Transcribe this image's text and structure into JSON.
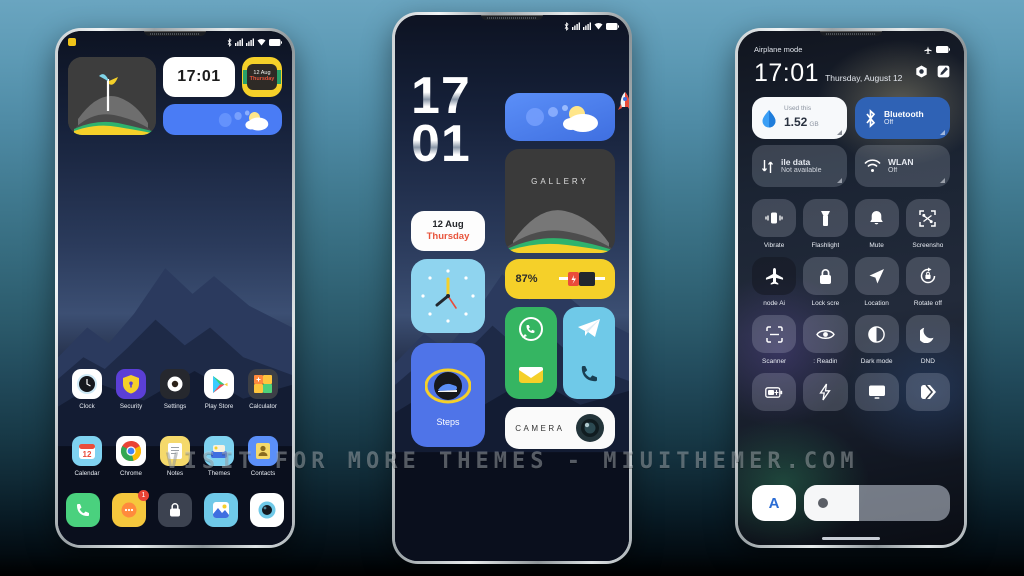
{
  "watermark": "VISIT FOR MORE THEMES - MIUITHEMER.COM",
  "colors": {
    "accent_yellow": "#f5d029",
    "accent_blue": "#4a7cf5",
    "accent_green": "#35b562",
    "accent_red": "#e8543c",
    "cyan": "#6fc9e8",
    "bg_top": "#6aa5c0",
    "bg_bottom": "#000000"
  },
  "phone1": {
    "name": "home-screen",
    "statusbar": {
      "left_badge_icon": "yellow-badge-icon",
      "icons": [
        "bluetooth-icon",
        "signal-1-icon",
        "signal-2-icon",
        "wifi-icon",
        "battery-icon"
      ]
    },
    "widgets": {
      "photo_widget_name": "photo-widget",
      "clock_time": "17:01",
      "date_day": "12 Aug",
      "date_weekday": "Thursday",
      "weather_widget_name": "weather-widget"
    },
    "apps_row1": [
      {
        "label": "Clock",
        "icon": "clock-icon"
      },
      {
        "label": "Security",
        "icon": "shield-icon"
      },
      {
        "label": "Settings",
        "icon": "gear-icon"
      },
      {
        "label": "Play Store",
        "icon": "play-store-icon"
      },
      {
        "label": "Calculator",
        "icon": "calculator-icon"
      }
    ],
    "apps_row2": [
      {
        "label": "Calendar",
        "icon": "calendar-icon"
      },
      {
        "label": "Chrome",
        "icon": "chrome-icon"
      },
      {
        "label": "Notes",
        "icon": "notes-icon"
      },
      {
        "label": "Themes",
        "icon": "themes-icon"
      },
      {
        "label": "Contacts",
        "icon": "contacts-icon"
      }
    ],
    "page_dots": 2,
    "page_active": 1,
    "dock": [
      {
        "name": "phone",
        "icon": "phone-icon"
      },
      {
        "name": "messages",
        "icon": "messages-icon",
        "badge": "1"
      },
      {
        "name": "app-lock",
        "icon": "lock-icon"
      },
      {
        "name": "gallery",
        "icon": "gallery-icon"
      },
      {
        "name": "camera",
        "icon": "camera-icon"
      }
    ]
  },
  "phone2": {
    "name": "widget-home-screen",
    "statusbar": {
      "icons": [
        "bluetooth-icon",
        "signal-1-icon",
        "signal-2-icon",
        "wifi-icon",
        "battery-icon"
      ]
    },
    "clock_hour": "17",
    "clock_minute": "01",
    "date_day": "12 Aug",
    "date_weekday": "Thursday",
    "weather_widget_name": "weather-widget",
    "rocket_icon": "rocket-icon",
    "gallery_label": "GALLERY",
    "analog_clock_name": "analog-clock-widget",
    "battery_percent": "87%",
    "steps_label": "Steps",
    "app_shortcuts": [
      "whatsapp-icon",
      "telegram-icon",
      "mail-icon",
      "phone-icon"
    ],
    "camera_label": "CAMERA"
  },
  "phone3": {
    "name": "control-center",
    "statusbar_label": "Airplane mode",
    "statusbar_icons": [
      "airplane-icon",
      "battery-icon"
    ],
    "time": "17:01",
    "date": "Thursday, August 12",
    "header_icons": [
      "settings-icon",
      "edit-icon"
    ],
    "big_tiles": [
      {
        "title": "Used this",
        "value": "1.52",
        "unit": "GB",
        "icon": "data-drop-icon",
        "style": "light"
      },
      {
        "title": "Bluetooth",
        "sub": "Off",
        "icon": "bluetooth-icon",
        "style": "blue"
      }
    ],
    "big_tiles_2": [
      {
        "title": "ile data",
        "sub": "Not available",
        "icon": "mobile-data-icon",
        "style": "dim"
      },
      {
        "title": "WLAN",
        "sub": "Off",
        "icon": "wifi-icon",
        "style": "dim"
      }
    ],
    "toggles": [
      {
        "label": "Vibrate",
        "icon": "vibrate-icon",
        "state": "off"
      },
      {
        "label": "Flashlight",
        "icon": "flashlight-icon",
        "state": "off"
      },
      {
        "label": "Mute",
        "icon": "bell-icon",
        "state": "off"
      },
      {
        "label": "Screensho",
        "icon": "screenshot-icon",
        "state": "off"
      },
      {
        "label": "node      Ai",
        "icon": "airplane-icon",
        "state": "on"
      },
      {
        "label": "Lock scre",
        "icon": "lock-icon",
        "state": "off"
      },
      {
        "label": "Location",
        "icon": "location-icon",
        "state": "off"
      },
      {
        "label": "Rotate off",
        "icon": "rotate-icon",
        "state": "off"
      },
      {
        "label": "Scanner",
        "icon": "scanner-icon",
        "state": "off"
      },
      {
        "label": ":     Readin",
        "icon": "eye-icon",
        "state": "off"
      },
      {
        "label": "Dark mode",
        "icon": "contrast-icon",
        "state": "off"
      },
      {
        "label": "DND",
        "icon": "moon-icon",
        "state": "off"
      },
      {
        "label": "",
        "icon": "battery-saver-icon",
        "state": "off"
      },
      {
        "label": "",
        "icon": "bolt-icon",
        "state": "off"
      },
      {
        "label": "",
        "icon": "cast-icon",
        "state": "off"
      },
      {
        "label": "",
        "icon": "second-space-icon",
        "state": "off"
      }
    ],
    "brightness": {
      "auto_label": "A",
      "level_percent": 38
    }
  }
}
